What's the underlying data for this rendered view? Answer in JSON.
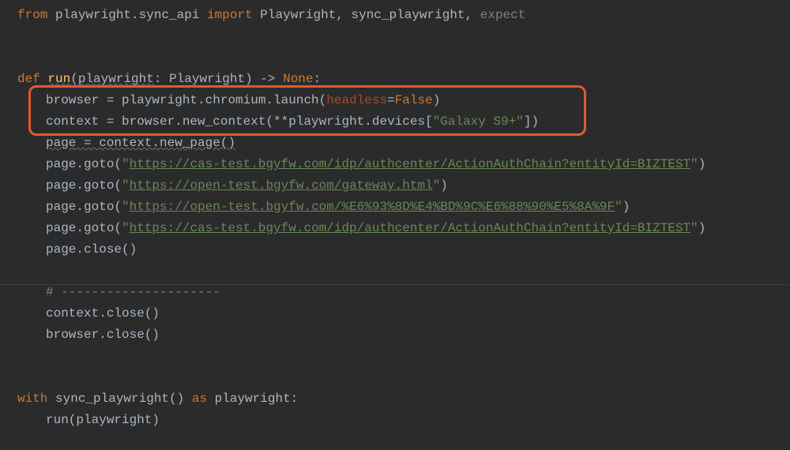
{
  "code": {
    "import_from": "from",
    "import_module": "playwright.sync_api",
    "import_kw": "import",
    "import_names": "Playwright, sync_playwright, ",
    "import_expect": "expect",
    "def_kw": "def",
    "def_name": "run",
    "def_sig_open": "(",
    "def_param": "playwright",
    "def_colon": ": Playwright) -> ",
    "def_ret": "None",
    "def_end": ":",
    "l1_pre": "browser = playwright.chromium.launch(",
    "l1_kw": "headless",
    "l1_eq": "=",
    "l1_val": "False",
    "l1_end": ")",
    "l2_pre": "context = browser.new_context(**playwright.devices[",
    "l2_str": "\"Galaxy S9+\"",
    "l2_end": "])",
    "l3": "page = context.new_page()",
    "goto_pre": "page.goto(",
    "goto_end": ")",
    "q": "\"",
    "url1": "https://cas-test.bgyfw.com/idp/authcenter/ActionAuthChain?entityId=BIZTEST",
    "url2": "https://open-test.bgyfw.com/gateway.html",
    "url3": "https://open-test.bgyfw.com/%E6%93%8D%E4%BD%9C%E6%88%90%E5%8A%9F",
    "url4": "https://cas-test.bgyfw.com/idp/authcenter/ActionAuthChain?entityId=BIZTEST",
    "page_close": "page.close()",
    "comment": "# ---------------------",
    "ctx_close": "context.close()",
    "br_close": "browser.close()",
    "with_kw": "with",
    "with_call": " sync_playwright() ",
    "as_kw": "as",
    "with_var": " playwright:",
    "run_call": "run(playwright)"
  }
}
